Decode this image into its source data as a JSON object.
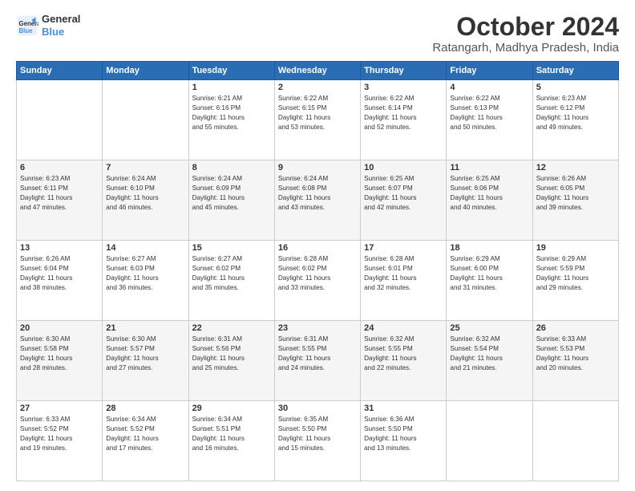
{
  "header": {
    "logo_line1": "General",
    "logo_line2": "Blue",
    "month": "October 2024",
    "location": "Ratangarh, Madhya Pradesh, India"
  },
  "weekdays": [
    "Sunday",
    "Monday",
    "Tuesday",
    "Wednesday",
    "Thursday",
    "Friday",
    "Saturday"
  ],
  "weeks": [
    [
      {
        "day": "",
        "info": ""
      },
      {
        "day": "",
        "info": ""
      },
      {
        "day": "1",
        "info": "Sunrise: 6:21 AM\nSunset: 6:16 PM\nDaylight: 11 hours\nand 55 minutes."
      },
      {
        "day": "2",
        "info": "Sunrise: 6:22 AM\nSunset: 6:15 PM\nDaylight: 11 hours\nand 53 minutes."
      },
      {
        "day": "3",
        "info": "Sunrise: 6:22 AM\nSunset: 6:14 PM\nDaylight: 11 hours\nand 52 minutes."
      },
      {
        "day": "4",
        "info": "Sunrise: 6:22 AM\nSunset: 6:13 PM\nDaylight: 11 hours\nand 50 minutes."
      },
      {
        "day": "5",
        "info": "Sunrise: 6:23 AM\nSunset: 6:12 PM\nDaylight: 11 hours\nand 49 minutes."
      }
    ],
    [
      {
        "day": "6",
        "info": "Sunrise: 6:23 AM\nSunset: 6:11 PM\nDaylight: 11 hours\nand 47 minutes."
      },
      {
        "day": "7",
        "info": "Sunrise: 6:24 AM\nSunset: 6:10 PM\nDaylight: 11 hours\nand 46 minutes."
      },
      {
        "day": "8",
        "info": "Sunrise: 6:24 AM\nSunset: 6:09 PM\nDaylight: 11 hours\nand 45 minutes."
      },
      {
        "day": "9",
        "info": "Sunrise: 6:24 AM\nSunset: 6:08 PM\nDaylight: 11 hours\nand 43 minutes."
      },
      {
        "day": "10",
        "info": "Sunrise: 6:25 AM\nSunset: 6:07 PM\nDaylight: 11 hours\nand 42 minutes."
      },
      {
        "day": "11",
        "info": "Sunrise: 6:25 AM\nSunset: 6:06 PM\nDaylight: 11 hours\nand 40 minutes."
      },
      {
        "day": "12",
        "info": "Sunrise: 6:26 AM\nSunset: 6:05 PM\nDaylight: 11 hours\nand 39 minutes."
      }
    ],
    [
      {
        "day": "13",
        "info": "Sunrise: 6:26 AM\nSunset: 6:04 PM\nDaylight: 11 hours\nand 38 minutes."
      },
      {
        "day": "14",
        "info": "Sunrise: 6:27 AM\nSunset: 6:03 PM\nDaylight: 11 hours\nand 36 minutes."
      },
      {
        "day": "15",
        "info": "Sunrise: 6:27 AM\nSunset: 6:02 PM\nDaylight: 11 hours\nand 35 minutes."
      },
      {
        "day": "16",
        "info": "Sunrise: 6:28 AM\nSunset: 6:02 PM\nDaylight: 11 hours\nand 33 minutes."
      },
      {
        "day": "17",
        "info": "Sunrise: 6:28 AM\nSunset: 6:01 PM\nDaylight: 11 hours\nand 32 minutes."
      },
      {
        "day": "18",
        "info": "Sunrise: 6:29 AM\nSunset: 6:00 PM\nDaylight: 11 hours\nand 31 minutes."
      },
      {
        "day": "19",
        "info": "Sunrise: 6:29 AM\nSunset: 5:59 PM\nDaylight: 11 hours\nand 29 minutes."
      }
    ],
    [
      {
        "day": "20",
        "info": "Sunrise: 6:30 AM\nSunset: 5:58 PM\nDaylight: 11 hours\nand 28 minutes."
      },
      {
        "day": "21",
        "info": "Sunrise: 6:30 AM\nSunset: 5:57 PM\nDaylight: 11 hours\nand 27 minutes."
      },
      {
        "day": "22",
        "info": "Sunrise: 6:31 AM\nSunset: 5:56 PM\nDaylight: 11 hours\nand 25 minutes."
      },
      {
        "day": "23",
        "info": "Sunrise: 6:31 AM\nSunset: 5:55 PM\nDaylight: 11 hours\nand 24 minutes."
      },
      {
        "day": "24",
        "info": "Sunrise: 6:32 AM\nSunset: 5:55 PM\nDaylight: 11 hours\nand 22 minutes."
      },
      {
        "day": "25",
        "info": "Sunrise: 6:32 AM\nSunset: 5:54 PM\nDaylight: 11 hours\nand 21 minutes."
      },
      {
        "day": "26",
        "info": "Sunrise: 6:33 AM\nSunset: 5:53 PM\nDaylight: 11 hours\nand 20 minutes."
      }
    ],
    [
      {
        "day": "27",
        "info": "Sunrise: 6:33 AM\nSunset: 5:52 PM\nDaylight: 11 hours\nand 19 minutes."
      },
      {
        "day": "28",
        "info": "Sunrise: 6:34 AM\nSunset: 5:52 PM\nDaylight: 11 hours\nand 17 minutes."
      },
      {
        "day": "29",
        "info": "Sunrise: 6:34 AM\nSunset: 5:51 PM\nDaylight: 11 hours\nand 16 minutes."
      },
      {
        "day": "30",
        "info": "Sunrise: 6:35 AM\nSunset: 5:50 PM\nDaylight: 11 hours\nand 15 minutes."
      },
      {
        "day": "31",
        "info": "Sunrise: 6:36 AM\nSunset: 5:50 PM\nDaylight: 11 hours\nand 13 minutes."
      },
      {
        "day": "",
        "info": ""
      },
      {
        "day": "",
        "info": ""
      }
    ]
  ]
}
